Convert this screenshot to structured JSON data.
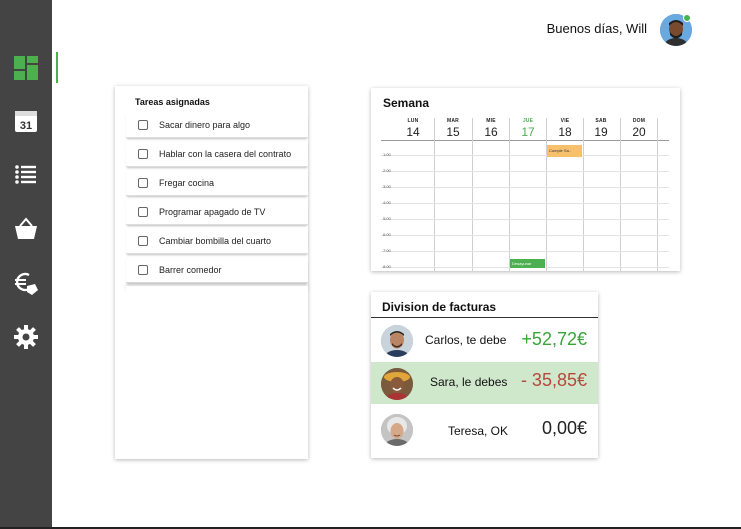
{
  "header": {
    "greeting": "Buenos días, Will"
  },
  "sidebar": {
    "items": [
      {
        "icon": "dashboard-icon",
        "active": true
      },
      {
        "icon": "calendar-icon",
        "badge": "31"
      },
      {
        "icon": "list-icon"
      },
      {
        "icon": "basket-icon"
      },
      {
        "icon": "euro-hand-icon"
      },
      {
        "icon": "gear-icon"
      }
    ]
  },
  "tasks": {
    "title": "Tareas asignadas",
    "items": [
      "Sacar dinero para algo",
      "Hablar con la casera del contrato",
      "Fregar cocina",
      "Programar apagado de TV",
      "Cambiar bombilla del cuarto",
      "Barrer comedor"
    ]
  },
  "week": {
    "title": "Semana",
    "days": [
      {
        "name": "LUN",
        "num": "14"
      },
      {
        "name": "MAR",
        "num": "15"
      },
      {
        "name": "MIE",
        "num": "16"
      },
      {
        "name": "JUE",
        "num": "17",
        "today": true
      },
      {
        "name": "VIE",
        "num": "18"
      },
      {
        "name": "SAB",
        "num": "19"
      },
      {
        "name": "DOM",
        "num": "20"
      }
    ],
    "hours": [
      "1:00",
      "2:00",
      "3:00",
      "4:00",
      "5:00",
      "6:00",
      "7:00",
      "8:00"
    ],
    "events": {
      "orange": "Cumple Sa..",
      "green": "Desayunar"
    }
  },
  "bills": {
    "title": "Division de facturas",
    "rows": [
      {
        "name": "Carlos, te debe",
        "amount": "+52,72€",
        "color": "#3aa43a"
      },
      {
        "name": "Sara, le debes",
        "amount": "- 35,85€",
        "color": "#b5483c"
      },
      {
        "name": "Teresa, OK",
        "amount": "0,00€",
        "color": "#222222"
      }
    ]
  },
  "colors": {
    "accent": "#4caf50",
    "sidebar": "#444444",
    "debt_row": "#cfe8cc"
  }
}
